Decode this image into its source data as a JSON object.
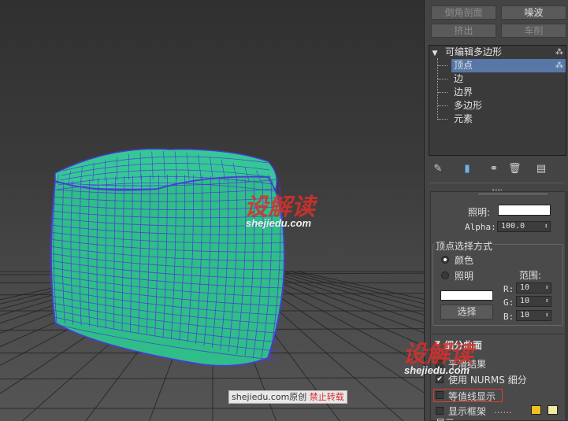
{
  "toolbar": {
    "row1": [
      "倒角剖面",
      "噪波"
    ],
    "row2": [
      "挤出",
      "车削"
    ]
  },
  "stack": {
    "root": "可编辑多边形",
    "items": [
      "顶点",
      "边",
      "边界",
      "多边形",
      "元素"
    ],
    "selected": "顶点"
  },
  "rollout": {
    "illum_label": "照明:",
    "alpha_label": "Alpha:",
    "alpha_value": "100.0",
    "vertex_select_group": "顶点选择方式",
    "radio_color": "颜色",
    "radio_illum": "照明",
    "range_label": "范围:",
    "r_label": "R:",
    "g_label": "G:",
    "b_label": "B:",
    "r_value": "10",
    "g_value": "10",
    "b_value": "10",
    "select_button": "选择",
    "subdiv_header": "细分曲面",
    "smooth_result": "平滑结果",
    "use_nurms": "使用 NURMS 细分",
    "isoline_display": "等值线显示",
    "show_cage": "显示框架",
    "cage_dots": "......",
    "display_label": "显示"
  },
  "watermark": {
    "logo_text": "设解读",
    "logo_url": "shejiedu.com",
    "note_site": "shejiedu.com原创",
    "note_forbid": "禁止转载"
  },
  "colors": {
    "mesh_fill": "#2fbd8a",
    "wire": "#4a3bd6",
    "selection": "#5777a7",
    "watermark_red": "#d9302b",
    "cage_color1": "#f0c020",
    "cage_color2": "#f3eaa0"
  }
}
